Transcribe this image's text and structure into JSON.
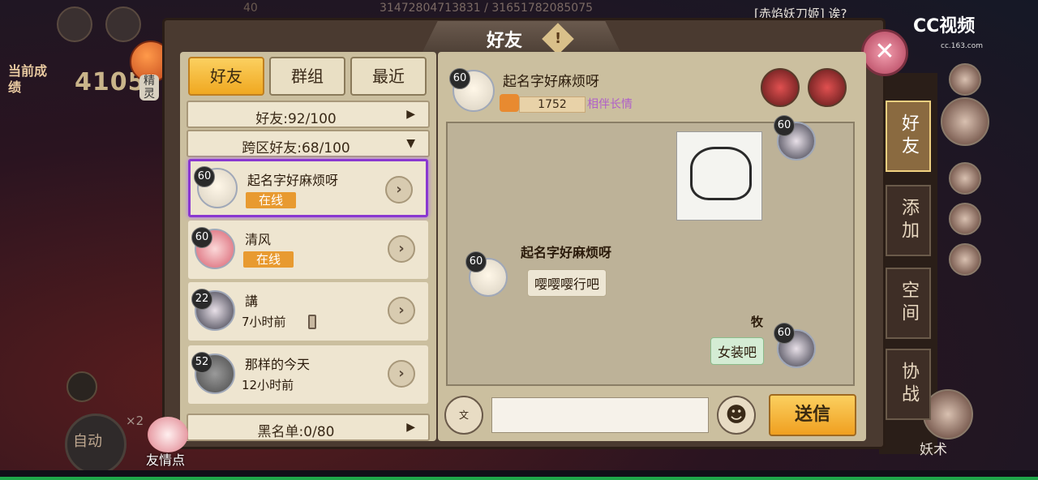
{
  "top": {
    "num_partial": "40",
    "ratio": "31472804713831 / 31651782085075",
    "live_text": "[赤焰妖刀姬] 诶?",
    "cc_logo": "CC视频",
    "cc_url": "cc.163.com"
  },
  "background": {
    "score_label": "当前成绩",
    "score_value": "4105",
    "spirit_label": "精灵",
    "auto_label": "自动",
    "x2": "×2",
    "friend_points_label": "友情点",
    "yaoshu_label": "妖术"
  },
  "panel": {
    "title": "好友",
    "help_icon": "!",
    "close_icon": "✕"
  },
  "tabs": [
    {
      "label": "好友",
      "active": true
    },
    {
      "label": "群组",
      "active": false
    },
    {
      "label": "最近",
      "active": false
    }
  ],
  "groups": {
    "friends": {
      "label": "好友:92/100",
      "arrow": "▶"
    },
    "cross": {
      "label": "跨区好友:68/100",
      "arrow": "▼"
    },
    "blacklist": {
      "label": "黑名单:0/80",
      "arrow": "▶"
    }
  },
  "friends": [
    {
      "name": "起名字好麻烦呀",
      "level": "60",
      "status": "在线",
      "online": true,
      "avatar": "white"
    },
    {
      "name": "清风",
      "level": "60",
      "status": "在线",
      "online": true,
      "avatar": "red"
    },
    {
      "name": "講",
      "level": "22",
      "status": "7小时前",
      "online": false,
      "avatar": "dark"
    },
    {
      "name": "那样的今天",
      "level": "52",
      "status": "12小时前",
      "online": false,
      "avatar": "gray"
    }
  ],
  "chat": {
    "head": {
      "name": "起名字好麻烦呀",
      "level": "60",
      "intimacy": "1752",
      "intimacy_title": "相伴长情"
    },
    "messages": {
      "sticker_level": "60",
      "sender_name": "起名字好麻烦呀",
      "sender_level": "60",
      "sender_text": "嘤嘤嘤行吧",
      "my_name": "牧",
      "my_level": "60",
      "my_text": "女装吧"
    },
    "voice_label": "文",
    "input_value": "",
    "input_placeholder": "",
    "emoji_icon": "☻",
    "send_label": "送信"
  },
  "side_tabs": [
    {
      "label": "好友",
      "active": true
    },
    {
      "label": "添加",
      "active": false
    },
    {
      "label": "空间",
      "active": false
    },
    {
      "label": "协战",
      "active": false
    }
  ],
  "colors": {
    "accent_gold": "#f0a820",
    "online_orange": "#e89a30",
    "selected_purple": "#8a38d0",
    "intimacy_purple": "#b060c8"
  }
}
